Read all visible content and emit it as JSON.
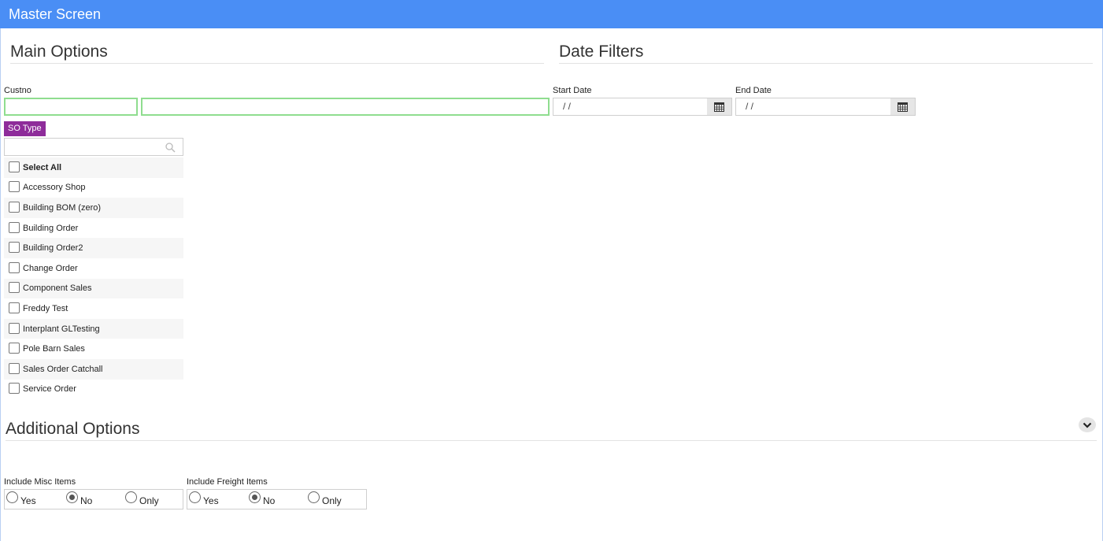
{
  "header": {
    "title": "Master Screen"
  },
  "main_options": {
    "heading": "Main Options",
    "custno_label": "Custno",
    "custno_value": "",
    "custname_value": "",
    "so_type": {
      "badge": "SO Type",
      "search_value": "",
      "items": [
        {
          "label": "Select All",
          "checked": false
        },
        {
          "label": "Accessory Shop",
          "checked": false
        },
        {
          "label": "Building BOM (zero)",
          "checked": false
        },
        {
          "label": "Building Order",
          "checked": false
        },
        {
          "label": "Building Order2",
          "checked": false
        },
        {
          "label": "Change Order",
          "checked": false
        },
        {
          "label": "Component Sales",
          "checked": false
        },
        {
          "label": "Freddy Test",
          "checked": false
        },
        {
          "label": "Interplant GLTesting",
          "checked": false
        },
        {
          "label": "Pole Barn Sales",
          "checked": false
        },
        {
          "label": "Sales Order Catchall",
          "checked": false
        },
        {
          "label": "Service Order",
          "checked": false
        }
      ]
    }
  },
  "date_filters": {
    "heading": "Date Filters",
    "start_label": "Start Date",
    "start_value": " /  /",
    "end_label": "End Date",
    "end_value": " /  /"
  },
  "additional_options": {
    "heading": "Additional Options",
    "misc": {
      "label": "Include Misc Items",
      "options": [
        "Yes",
        "No",
        "Only"
      ],
      "selected": "No"
    },
    "freight": {
      "label": "Include Freight Items",
      "options": [
        "Yes",
        "No",
        "Only"
      ],
      "selected": "No"
    }
  },
  "colors": {
    "header_bg": "#4a8ef5",
    "badge_bg": "#8e2c9a",
    "input_border": "#8fdd8f"
  }
}
